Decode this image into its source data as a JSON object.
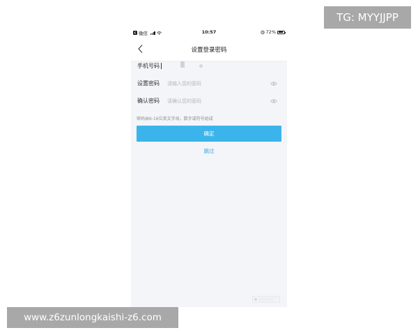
{
  "status_bar": {
    "carrier": "微信",
    "time": "10:57",
    "battery_text": "72%",
    "battery_level": 0.72
  },
  "nav": {
    "title": "设置登录密码",
    "back_icon": "chevron-left-icon"
  },
  "form": {
    "phone": {
      "label": "手机号码"
    },
    "password": {
      "label": "设置密码",
      "placeholder": "请输入您的密码"
    },
    "confirm_password": {
      "label": "确认密码",
      "placeholder": "请确认您的密码"
    },
    "hint": "密码由6-16位英文字母，数字或符号组成"
  },
  "actions": {
    "confirm_label": "确定",
    "skip_label": "跳过"
  },
  "overlays": {
    "tg_label": "TG: MYYJJPP",
    "url_label": "www.z6zunlongkaishi-z6.com"
  },
  "colors": {
    "accent": "#3bb4ec",
    "link": "#3aa8e0",
    "page_bg": "#f3f5f8",
    "badge_bg": "#a8a8a8"
  }
}
